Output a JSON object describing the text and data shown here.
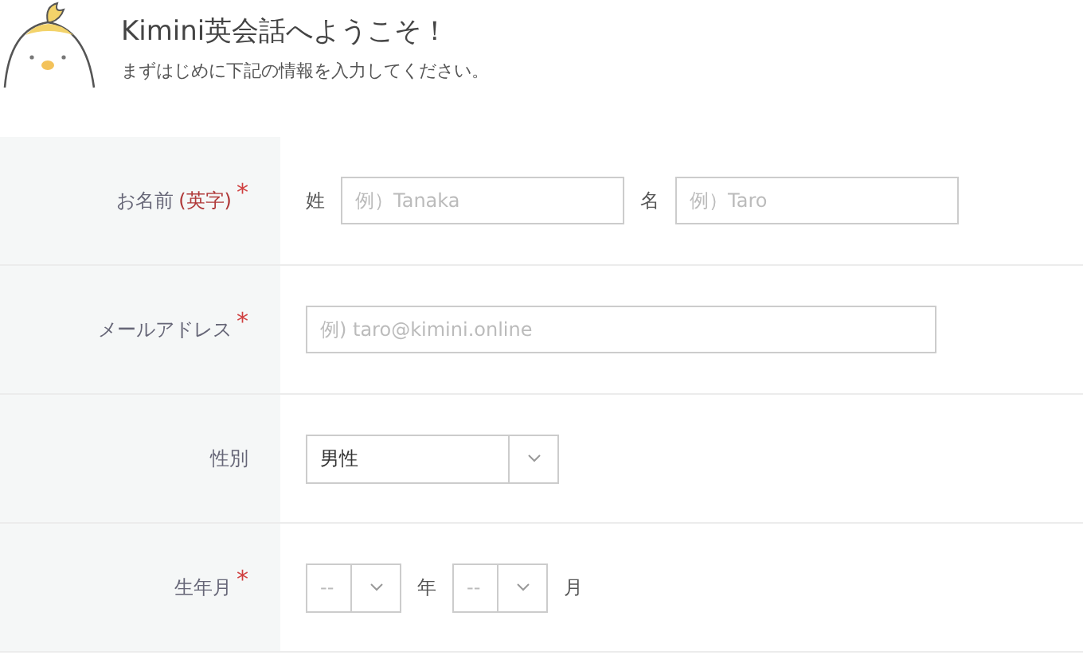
{
  "header": {
    "title": "Kimini英会話へようこそ！",
    "subtitle": "まずはじめに下記の情報を入力してください。"
  },
  "rows": [
    {
      "kind": "name",
      "label": "お名前",
      "label_note": "(英字)",
      "required_mark": "*",
      "fields": [
        {
          "prefix": "姓",
          "placeholder": "例）Tanaka"
        },
        {
          "prefix": "名",
          "placeholder": "例）Taro"
        }
      ]
    },
    {
      "kind": "email",
      "label": "メールアドレス",
      "required_mark": "*",
      "placeholder": "例) taro@kimini.online"
    },
    {
      "kind": "select",
      "label": "性別",
      "value": "男性"
    },
    {
      "kind": "yearmonth",
      "label": "生年月",
      "required_mark": "*",
      "parts": [
        {
          "placeholder": "--",
          "suffix": "年"
        },
        {
          "placeholder": "--",
          "suffix": "月"
        }
      ]
    }
  ]
}
